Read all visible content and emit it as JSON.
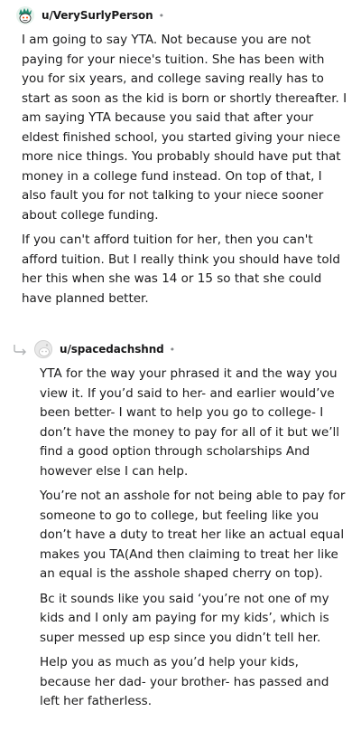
{
  "comment": {
    "username": "u/VerySurlyPerson",
    "separator": "•",
    "paragraphs": [
      "I am going to say YTA. Not because you are not paying for your niece's tuition. She has been with you for six years, and college saving really has to start as soon as the kid is born or shortly thereafter. I am saying YTA because you said that after your eldest finished school, you started giving your niece more nice things. You probably should have put that money in a college fund instead. On top of that, I also fault you for not talking to your niece sooner about college funding.",
      "If you can't afford tuition for her, then you can't afford tuition. But I really think you should have told her this when she was 14 or 15 so that she could have planned better."
    ]
  },
  "reply": {
    "username": "u/spacedachshnd",
    "separator": "•",
    "paragraphs": [
      "YTA for the way your phrased it and the way you view it. If you’d said to her- and earlier would’ve been better- I want to help you go to college- I don’t have the money to pay for all of it but we’ll find a good option through scholarships And however else I can help.",
      "You’re not an asshole for not being able to pay for someone to go to college, but feeling like you don’t have a duty to treat her like an actual equal makes you TA(And then claiming to treat her like an equal is the asshole shaped cherry on top).",
      "Bc it sounds like you said ‘you’re not one of my kids and I only am paying for my kids’, which is super messed up esp since you didn’t tell her.",
      "Help you as much as you’d help your kids, because her dad- your brother- has passed and left her fatherless."
    ]
  },
  "icons": {
    "main_avatar": "snoo-avatar-green-hair-icon",
    "reply_avatar": "default-snoo-avatar-icon",
    "reply_arrow": "reply-arrow-icon"
  }
}
